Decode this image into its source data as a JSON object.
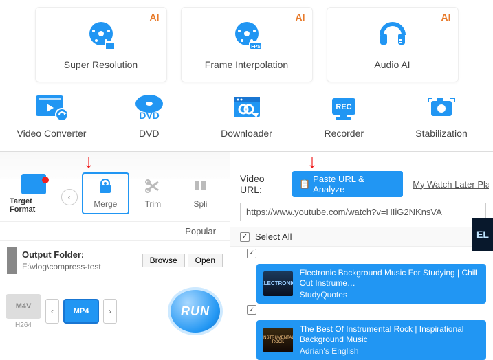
{
  "ai_badge": "AI",
  "ai_cards": [
    {
      "label": "Super Resolution"
    },
    {
      "label": "Frame Interpolation"
    },
    {
      "label": "Audio AI"
    }
  ],
  "tools": [
    {
      "label": "Video Converter"
    },
    {
      "label": "DVD"
    },
    {
      "label": "Downloader"
    },
    {
      "label": "Recorder"
    },
    {
      "label": "Stabilization"
    }
  ],
  "left": {
    "target_format": "Target Format",
    "merge": "Merge",
    "trim": "Trim",
    "split": "Spli",
    "tab_popular": "Popular",
    "output_folder_label": "Output Folder:",
    "output_folder_path": "F:\\vlog\\compress-test",
    "browse": "Browse",
    "open": "Open",
    "fmt_m4v": "M4V",
    "fmt_mp4": "MP4",
    "fmt_h264": "H264",
    "run": "RUN"
  },
  "right": {
    "video_url_label": "Video URL:",
    "paste_btn": "Paste URL & Analyze",
    "watch_later": "My Watch Later Pla",
    "url_value": "https://www.youtube.com/watch?v=HIiG2NKnsVA",
    "select_all": "Select All",
    "side_thumb": "EL",
    "items": [
      {
        "title": "Electronic Background Music For Studying | Chill Out Instrume…",
        "author": "StudyQuotes"
      },
      {
        "title": "The Best Of Instrumental Rock | Inspirational Background Music",
        "author": "Adrian's English"
      }
    ]
  }
}
